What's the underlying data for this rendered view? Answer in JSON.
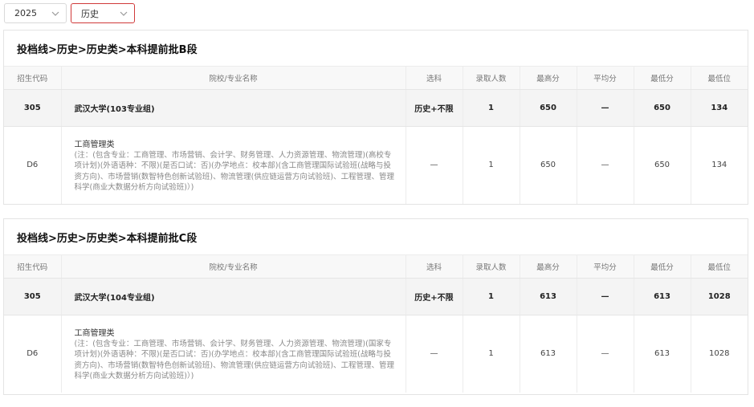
{
  "filters": {
    "year": "2025",
    "subject": "历史"
  },
  "columns": [
    "招生代码",
    "院校/专业名称",
    "选科",
    "录取人数",
    "最高分",
    "平均分",
    "最低分",
    "最低位"
  ],
  "sections": [
    {
      "title": "投档线>历史>历史类>本科提前批B段",
      "group": {
        "code": "305",
        "name": "武汉大学(103专业组)",
        "subject_req": "历史+不限",
        "admitted": "1",
        "max_score": "650",
        "avg_score": "—",
        "min_score": "650",
        "min_rank": "134"
      },
      "major": {
        "code": "D6",
        "name": "工商管理类",
        "note": "(注：(包含专业：工商管理、市场营销、会计学、财务管理、人力资源管理、物流管理)(高校专项计划)(外语语种：不限)(是否口试：否)(办学地点：校本部)(含工商管理国际试验班(战略与投资方向)、市场营销(数智特色创新试验班)、物流管理(供应链运营方向试验班)、工程管理、管理科学(商业大数据分析方向试验班)）)",
        "subject_req": "—",
        "admitted": "1",
        "max_score": "650",
        "avg_score": "—",
        "min_score": "650",
        "min_rank": "134"
      }
    },
    {
      "title": "投档线>历史>历史类>本科提前批C段",
      "group": {
        "code": "305",
        "name": "武汉大学(104专业组)",
        "subject_req": "历史+不限",
        "admitted": "1",
        "max_score": "613",
        "avg_score": "—",
        "min_score": "613",
        "min_rank": "1028"
      },
      "major": {
        "code": "D6",
        "name": "工商管理类",
        "note": "(注：(包含专业：工商管理、市场营销、会计学、财务管理、人力资源管理、物流管理)(国家专项计划)(外语语种：不限)(是否口试：否)(办学地点：校本部)(含工商管理国际试验班(战略与投资方向)、市场营销(数智特色创新试验班)、物流管理(供应链运营方向试验班)、工程管理、管理科学(商业大数据分析方向试验班)）)",
        "subject_req": "—",
        "admitted": "1",
        "max_score": "613",
        "avg_score": "—",
        "min_score": "613",
        "min_rank": "1028"
      }
    }
  ]
}
